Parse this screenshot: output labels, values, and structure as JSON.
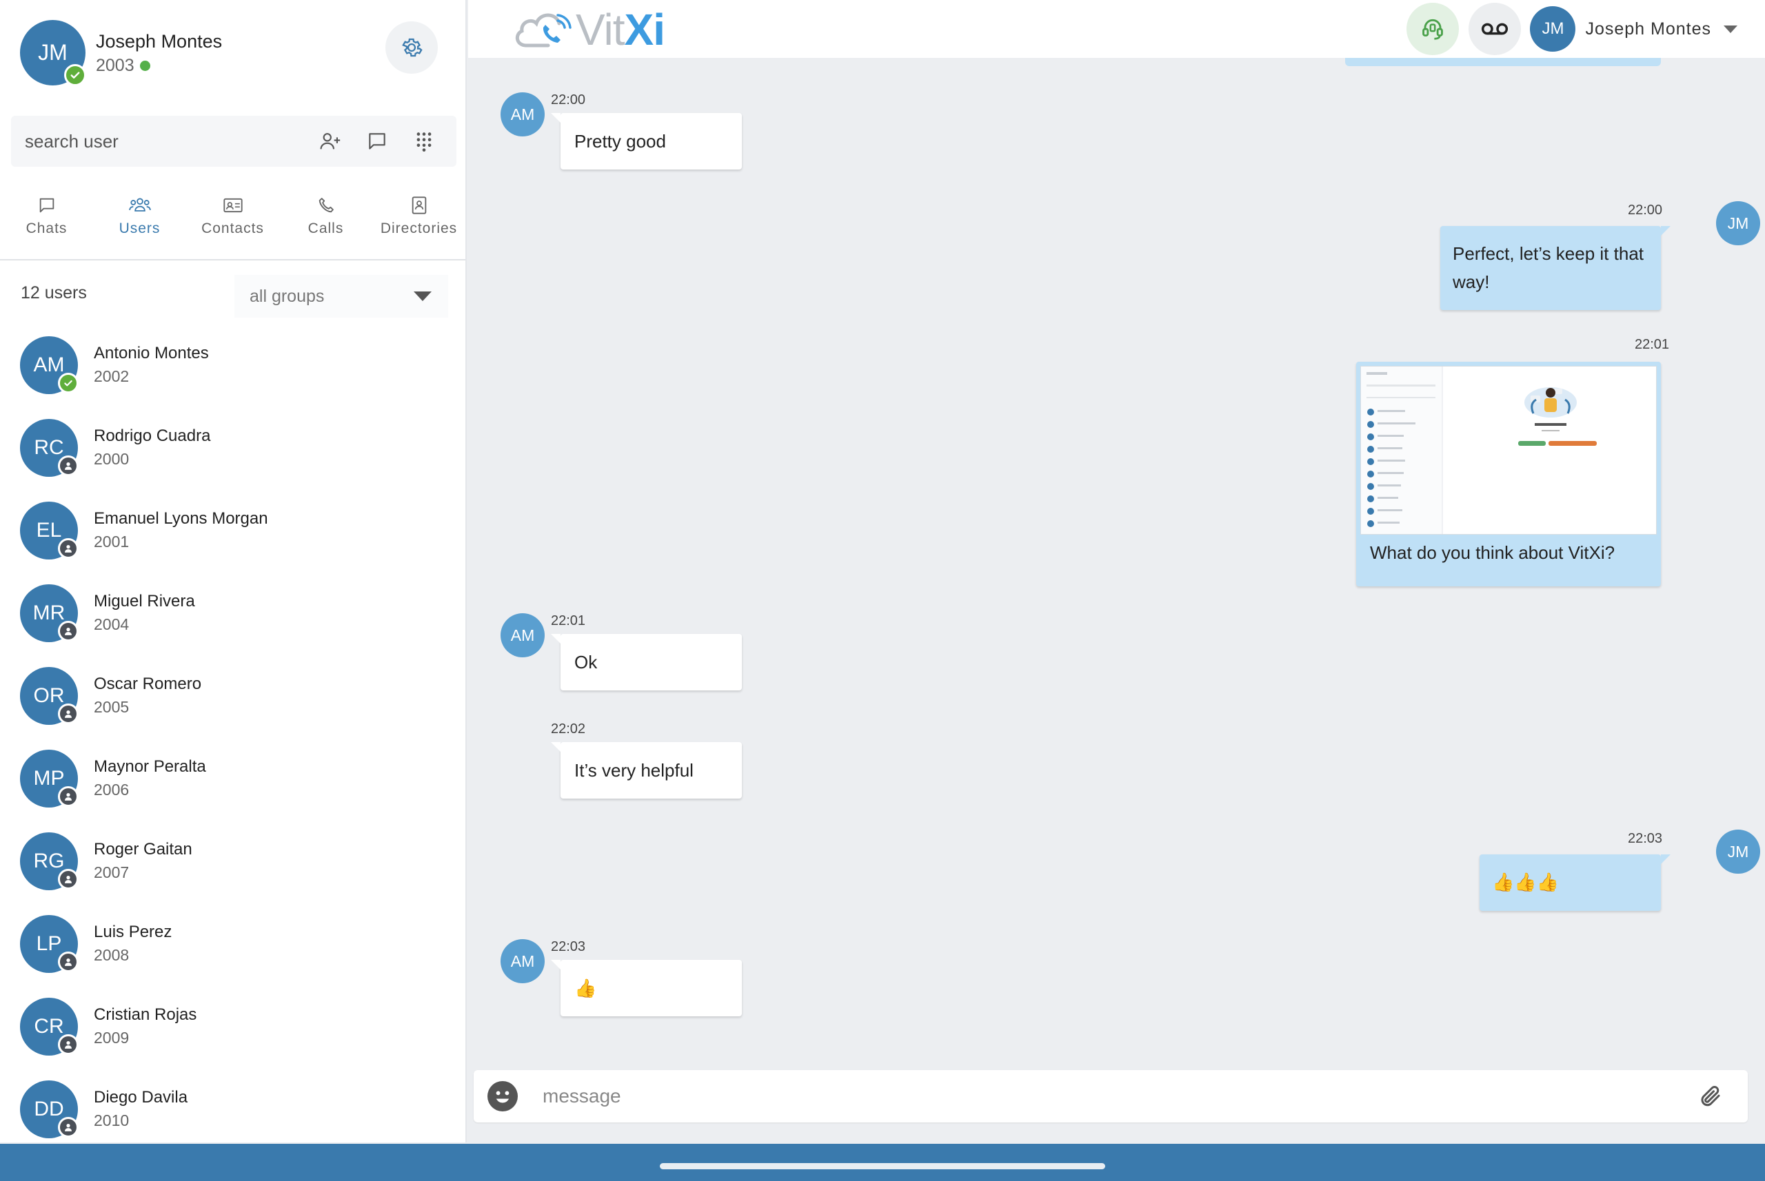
{
  "profile": {
    "initials": "JM",
    "name": "Joseph Montes",
    "extension": "2003"
  },
  "search": {
    "placeholder": "search user"
  },
  "tabs": [
    {
      "label": "Chats",
      "icon": "chat-icon"
    },
    {
      "label": "Users",
      "icon": "users-icon",
      "active": true
    },
    {
      "label": "Contacts",
      "icon": "contact-card-icon"
    },
    {
      "label": "Calls",
      "icon": "phone-icon"
    },
    {
      "label": "Directories",
      "icon": "directory-icon"
    }
  ],
  "list": {
    "count_label": "12 users",
    "group_filter": "all groups"
  },
  "users": [
    {
      "initials": "AM",
      "name": "Antonio Montes",
      "ext": "2002",
      "status": "available"
    },
    {
      "initials": "RC",
      "name": "Rodrigo Cuadra",
      "ext": "2000",
      "status": "offline"
    },
    {
      "initials": "EL",
      "name": "Emanuel Lyons Morgan",
      "ext": "2001",
      "status": "offline"
    },
    {
      "initials": "MR",
      "name": "Miguel Rivera",
      "ext": "2004",
      "status": "offline"
    },
    {
      "initials": "OR",
      "name": "Oscar Romero",
      "ext": "2005",
      "status": "offline"
    },
    {
      "initials": "MP",
      "name": "Maynor Peralta",
      "ext": "2006",
      "status": "offline"
    },
    {
      "initials": "RG",
      "name": "Roger Gaitan",
      "ext": "2007",
      "status": "offline"
    },
    {
      "initials": "LP",
      "name": "Luis Perez",
      "ext": "2008",
      "status": "offline"
    },
    {
      "initials": "CR",
      "name": "Cristian Rojas",
      "ext": "2009",
      "status": "offline"
    },
    {
      "initials": "DD",
      "name": "Diego Davila",
      "ext": "2010",
      "status": "offline"
    }
  ],
  "topbar": {
    "logo_prefix": "Vit",
    "logo_suffix": "Xi",
    "user_initials": "JM",
    "user_name": "Joseph Montes"
  },
  "messages": [
    {
      "direction": "in",
      "initials": "AM",
      "time": "22:00",
      "text": "Pretty good"
    },
    {
      "direction": "out",
      "initials": "JM",
      "time": "22:00",
      "text": "Perfect, let’s keep it that way!"
    },
    {
      "direction": "out",
      "time": "22:01",
      "text": "What do you think about VitXi?",
      "has_image": true
    },
    {
      "direction": "in",
      "initials": "AM",
      "time": "22:01",
      "text": "Ok"
    },
    {
      "direction": "in",
      "time": "22:02",
      "text": "It’s very helpful"
    },
    {
      "direction": "out",
      "initials": "JM",
      "time": "22:03",
      "text": "👍👍👍"
    },
    {
      "direction": "in",
      "initials": "AM",
      "time": "22:03",
      "text": "👍"
    }
  ],
  "composer": {
    "placeholder": "message"
  },
  "colors": {
    "accent": "#3a7aad",
    "outgoing_bubble": "#bfe0f6",
    "online": "#55b04a"
  }
}
